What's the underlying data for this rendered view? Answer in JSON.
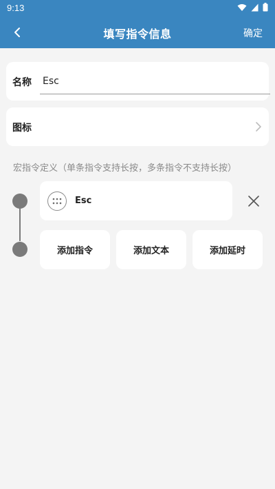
{
  "status_bar": {
    "time": "9:13",
    "icons": [
      "wifi-icon",
      "signal-icon",
      "battery-icon"
    ]
  },
  "app_bar": {
    "title": "填写指令信息",
    "confirm_label": "确定",
    "back_icon": "chevron-left-icon"
  },
  "name_field": {
    "label": "名称",
    "value": "Esc"
  },
  "icon_field": {
    "label": "图标",
    "chevron_icon": "chevron-right-icon"
  },
  "macro_section": {
    "hint": "宏指令定义（单条指令支持长按，多条指令不支持长按）"
  },
  "commands": [
    {
      "label": "Esc",
      "icon": "keypad-icon"
    }
  ],
  "actions": {
    "add_command": "添加指令",
    "add_text": "添加文本",
    "add_delay": "添加延时"
  },
  "colors": {
    "accent": "#3a86c0",
    "background": "#f4f4f4",
    "card": "#ffffff",
    "timeline": "#7a7a7a",
    "hint_text": "#8a8a8a"
  }
}
